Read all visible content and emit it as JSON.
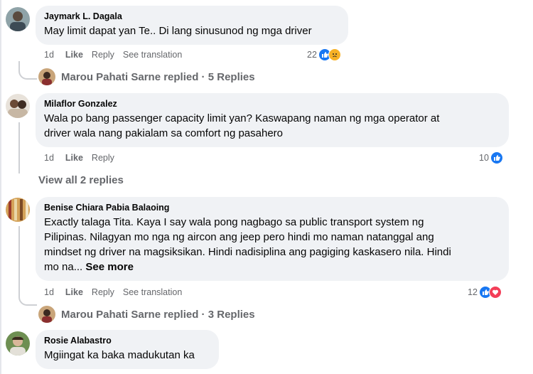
{
  "comments": [
    {
      "author": "Jaymark L. Dagala",
      "text": "May limit dapat yan Te.. Di lang sinusunod ng mga driver",
      "time": "1d",
      "like": "Like",
      "reply": "Reply",
      "translate": "See translation",
      "reaction_count": "22",
      "reactions": [
        "like-icon",
        "sad-icon"
      ],
      "replies_author": "Marou Pahati Sarne replied",
      "replies_count": "5 Replies"
    },
    {
      "author": "Milaflor Gonzalez",
      "text_line1": "Wala po bang passenger capacity limit yan? Kaswapang naman ng mga operator at",
      "text_line2": "driver wala nang pakialam sa comfort ng pasahero",
      "time": "1d",
      "like": "Like",
      "reply": "Reply",
      "reaction_count": "10",
      "reactions": [
        "like-icon"
      ],
      "view_all": "View all 2 replies"
    },
    {
      "author": "Benise Chiara Pabia Balaoing",
      "text_line1": "Exactly talaga Tita. Kaya I say wala pong nagbago sa public transport system ng",
      "text_line2": "Pilipinas. Nilagyan mo nga ng aircon ang jeep pero hindi mo naman natanggal ang",
      "text_line3": "mindset ng driver na magsiksikan. Hindi nadisiplina ang pagiging kaskasero nila. Hindi",
      "text_line4": "mo na...",
      "see_more": "See more",
      "time": "1d",
      "like": "Like",
      "reply": "Reply",
      "translate": "See translation",
      "reaction_count": "12",
      "reactions": [
        "like-icon",
        "love-icon"
      ],
      "replies_author": "Marou Pahati Sarne replied",
      "replies_count": "3 Replies"
    },
    {
      "author": "Rosie Alabastro",
      "text": "Mgiingat ka baka madukutan ka"
    }
  ],
  "separator": " · ",
  "colors": {
    "bubble": "#f0f2f5",
    "like": "#1877f2",
    "sad": "#f7b125",
    "love": "#f33e58",
    "muted": "#65676b"
  }
}
